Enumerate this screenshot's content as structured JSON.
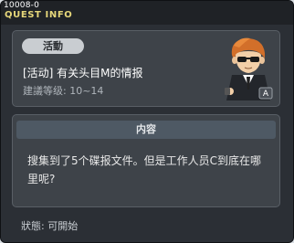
{
  "window": {
    "quest_id": "10008-0",
    "title": "QUEST INFO"
  },
  "quest": {
    "tag": "活動",
    "name": "[活动] 有关头目M的情报",
    "level": "建議等级: 10~14"
  },
  "content": {
    "header": "内容",
    "text": "搜集到了5个碟报文件。但是工作人员C到底在哪里呢?"
  },
  "status": {
    "text": "狀態: 可開始"
  }
}
